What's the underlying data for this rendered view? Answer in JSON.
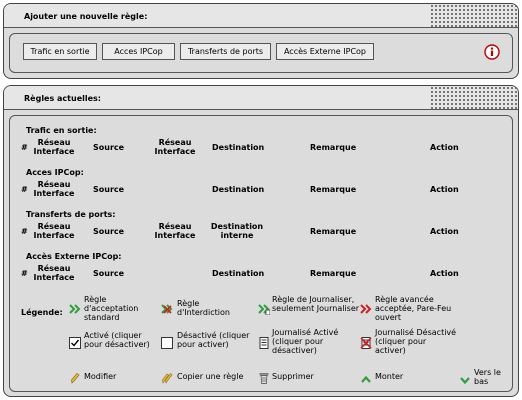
{
  "add_panel": {
    "title": "Ajouter une nouvelle règle:",
    "buttons": [
      "Trafic en sortie",
      "Acces IPCop",
      "Transferts de ports",
      "Accès Externe IPCop"
    ],
    "info_icon": "info-icon"
  },
  "rules_panel": {
    "title": "Règles actuelles:",
    "sections": [
      {
        "title": "Trafic en sortie:",
        "columns": {
          "num": "#",
          "src_net": "Réseau Interface",
          "source": "Source",
          "dst_net": "Réseau Interface",
          "destination": "Destination",
          "remark": "Remarque",
          "action": "Action"
        }
      },
      {
        "title": "Acces IPCop:",
        "columns": {
          "num": "#",
          "src_net": "Réseau Interface",
          "source": "Source",
          "destination": "Destination",
          "remark": "Remarque",
          "action": "Action"
        }
      },
      {
        "title": "Transferts de ports:",
        "columns": {
          "num": "#",
          "src_net": "Réseau Interface",
          "source": "Source",
          "dst_net": "Réseau Interface",
          "destination": "Destination interne",
          "remark": "Remarque",
          "action": "Action"
        }
      },
      {
        "title": "Accès Externe IPCop:",
        "columns": {
          "num": "#",
          "src_net": "Réseau Interface",
          "source": "Source",
          "destination": "Destination",
          "remark": "Remarque",
          "action": "Action"
        }
      }
    ],
    "legend": {
      "label": "Légende:",
      "items": {
        "accept": "Règle d'acceptation standard",
        "deny": "Règle d'Interdiction",
        "log": "Règle de Journaliser, seulement Journaliser",
        "advanced": "Règle avancée acceptée, Pare-Feu ouvert",
        "enabled": "Activé (cliquer pour désactiver)",
        "disabled": "Désactivé (cliquer pour activer)",
        "log_on": "Journalisé Activé (cliquer pour désactiver)",
        "log_off": "Journalisé Désactivé (cliquer pour activer)",
        "edit": "Modifier",
        "copy": "Copier une règle",
        "remove": "Supprimer",
        "up": "Monter",
        "down": "Vers le bas"
      }
    }
  },
  "colors": {
    "panel_bg": "#dcdcdc",
    "accept_green": "#2e9e3e",
    "deny_red": "#cc2222",
    "edit_yellow": "#e8c040"
  }
}
